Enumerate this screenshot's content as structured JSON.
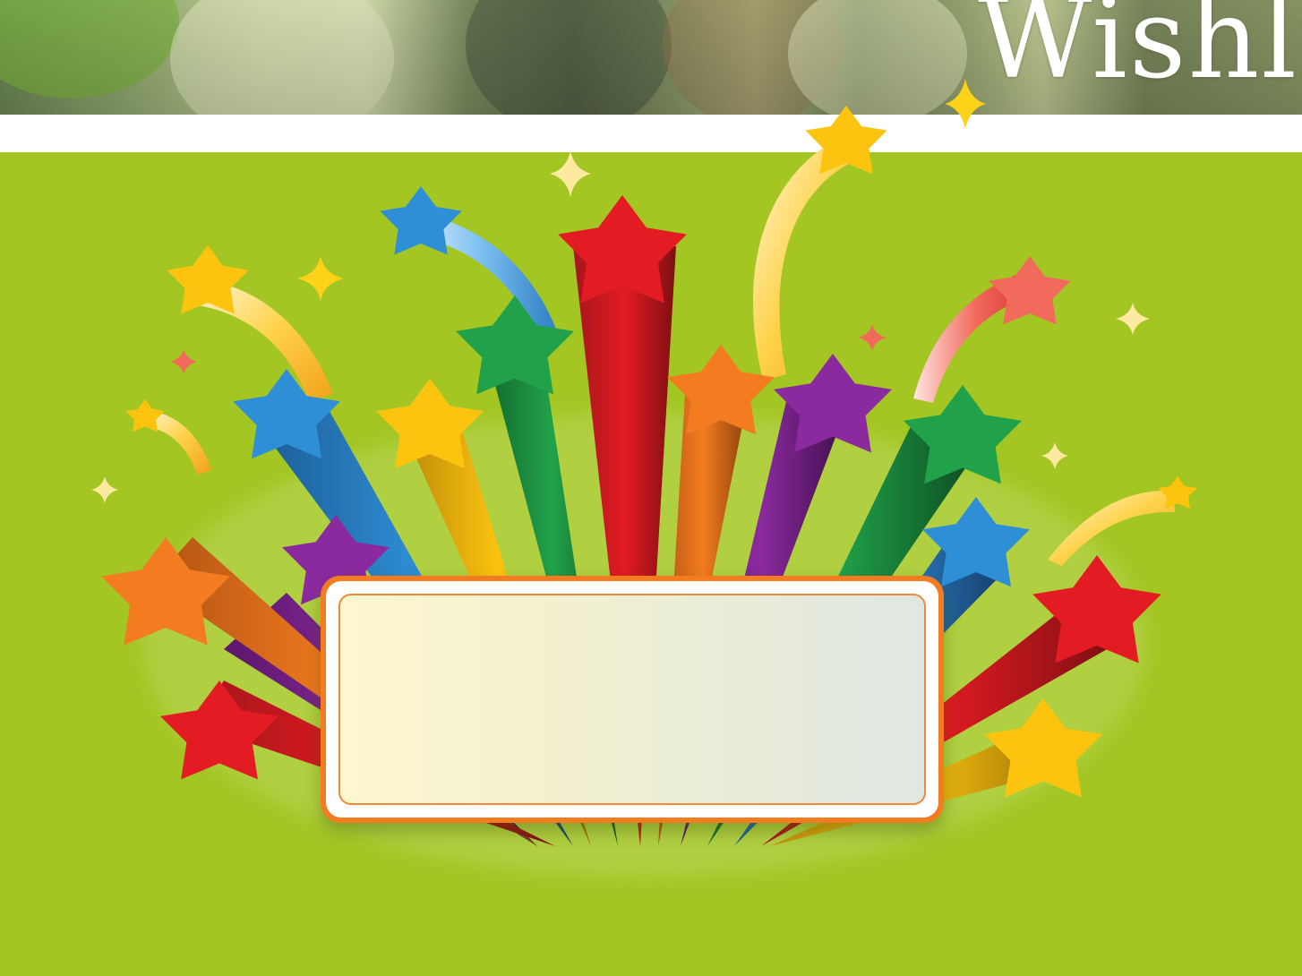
{
  "banner": {
    "title": "Wishli",
    "icon": "sparkle-icon"
  },
  "slide": {
    "background_color": "#a3c623",
    "illustration": "rainbow-star-burst",
    "placard_text": ""
  },
  "colors": {
    "red": "#e31b23",
    "orange": "#f47c20",
    "yellow": "#fcc40f",
    "green": "#21a24a",
    "blue": "#2f8fd6",
    "purple": "#8b2a9f",
    "placard_border": "#f47c20"
  }
}
